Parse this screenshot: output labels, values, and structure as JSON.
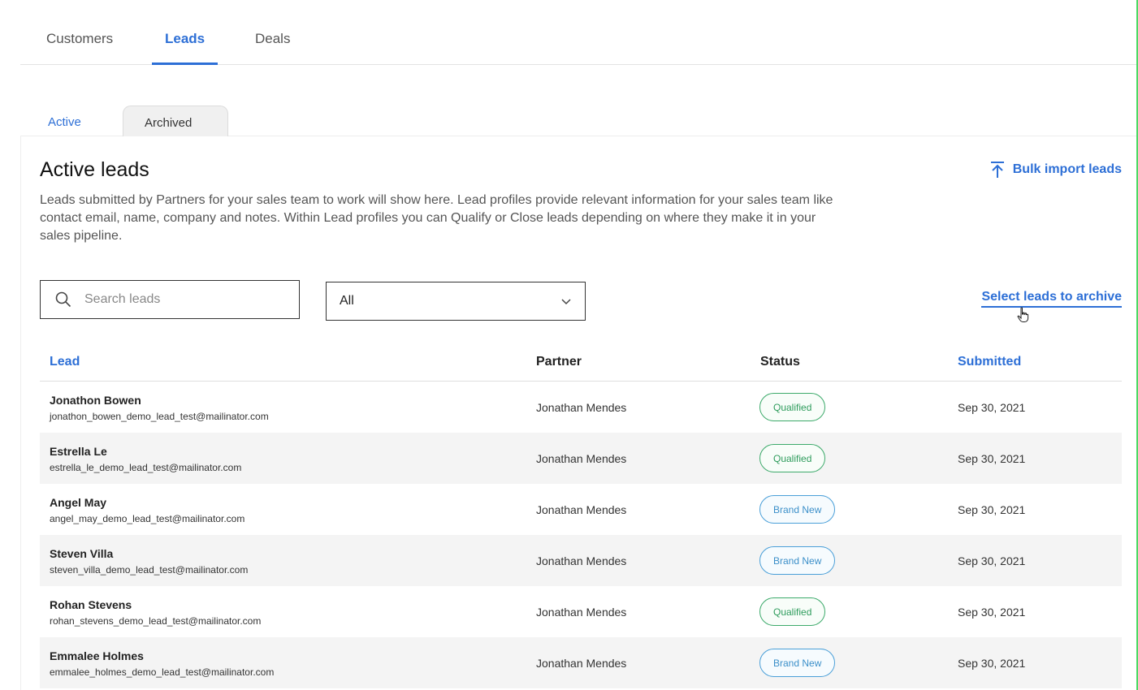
{
  "top_tabs": [
    {
      "label": "Customers"
    },
    {
      "label": "Leads"
    },
    {
      "label": "Deals"
    }
  ],
  "sub_tabs": {
    "active": "Active",
    "archived": "Archived"
  },
  "header": {
    "title": "Active leads",
    "description": "Leads submitted by Partners for your sales team to work will show here. Lead profiles provide relevant information for your sales team like contact email, name, company and notes. Within Lead profiles you can Qualify or Close leads depending on where they make it in your sales pipeline.",
    "bulk_import_label": "Bulk import leads"
  },
  "filters": {
    "search_placeholder": "Search leads",
    "select_value": "All",
    "archive_link": "Select leads to archive"
  },
  "table": {
    "columns": {
      "lead": "Lead",
      "partner": "Partner",
      "status": "Status",
      "submitted": "Submitted"
    },
    "rows": [
      {
        "name": "Jonathon Bowen",
        "email": "jonathon_bowen_demo_lead_test@mailinator.com",
        "partner": "Jonathan Mendes",
        "status": "Qualified",
        "submitted": "Sep 30, 2021"
      },
      {
        "name": "Estrella Le",
        "email": "estrella_le_demo_lead_test@mailinator.com",
        "partner": "Jonathan Mendes",
        "status": "Qualified",
        "submitted": "Sep 30, 2021"
      },
      {
        "name": "Angel May",
        "email": "angel_may_demo_lead_test@mailinator.com",
        "partner": "Jonathan Mendes",
        "status": "Brand New",
        "submitted": "Sep 30, 2021"
      },
      {
        "name": "Steven Villa",
        "email": "steven_villa_demo_lead_test@mailinator.com",
        "partner": "Jonathan Mendes",
        "status": "Brand New",
        "submitted": "Sep 30, 2021"
      },
      {
        "name": "Rohan Stevens",
        "email": "rohan_stevens_demo_lead_test@mailinator.com",
        "partner": "Jonathan Mendes",
        "status": "Qualified",
        "submitted": "Sep 30, 2021"
      },
      {
        "name": "Emmalee Holmes",
        "email": "emmalee_holmes_demo_lead_test@mailinator.com",
        "partner": "Jonathan Mendes",
        "status": "Brand New",
        "submitted": "Sep 30, 2021"
      }
    ]
  },
  "colors": {
    "accent": "#2d6fd6",
    "qualified": "#3daa6b",
    "brand_new": "#4a9fd8"
  }
}
